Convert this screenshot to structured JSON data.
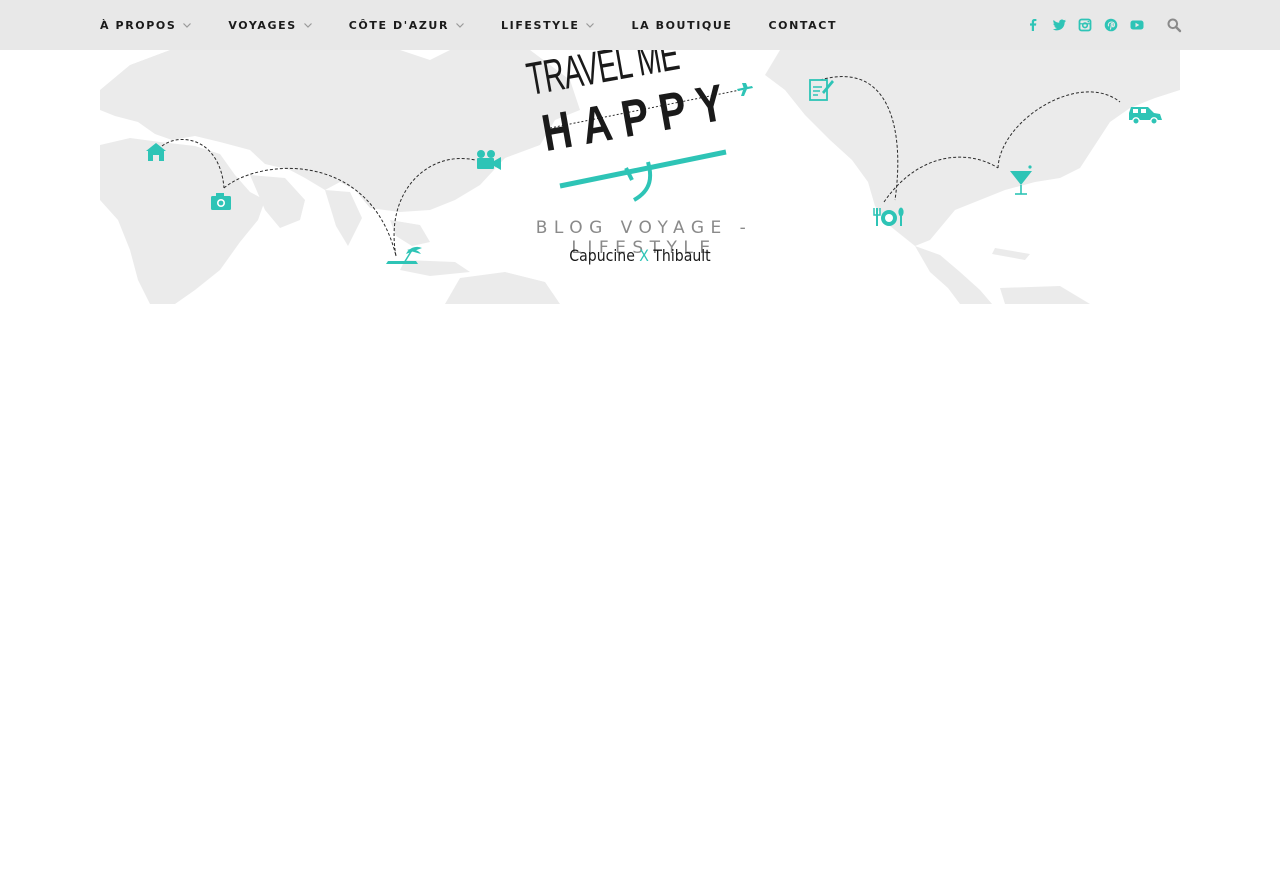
{
  "colors": {
    "accent": "#2ec4b6",
    "topbar_bg": "#e8e8e8",
    "nav_text": "#1b1b1b",
    "map_land": "#ebebeb",
    "tagline": "#8a8a8a"
  },
  "nav": {
    "items": [
      {
        "label": "À PROPOS",
        "has_dropdown": true
      },
      {
        "label": "VOYAGES",
        "has_dropdown": true
      },
      {
        "label": "CÔTE D'AZUR",
        "has_dropdown": true
      },
      {
        "label": "LIFESTYLE",
        "has_dropdown": true
      },
      {
        "label": "LA BOUTIQUE",
        "has_dropdown": false
      },
      {
        "label": "CONTACT",
        "has_dropdown": false
      }
    ]
  },
  "social": {
    "icons": [
      "facebook-icon",
      "twitter-icon",
      "instagram-icon",
      "pinterest-icon",
      "youtube-icon"
    ],
    "search_icon": "search-icon"
  },
  "header": {
    "logo_line1": "TRAVEL ME",
    "logo_line2": "HAPPY",
    "tagline": "BLOG VOYAGE - LIFESTYLE",
    "author1": "Capucine",
    "separator": "X",
    "author2": "Thibault"
  },
  "map_icons": [
    "home-icon",
    "camera-icon",
    "beach-umbrella-icon",
    "video-camera-icon",
    "plane-icon",
    "notepad-icon",
    "dining-icon",
    "cocktail-icon",
    "car-icon"
  ]
}
